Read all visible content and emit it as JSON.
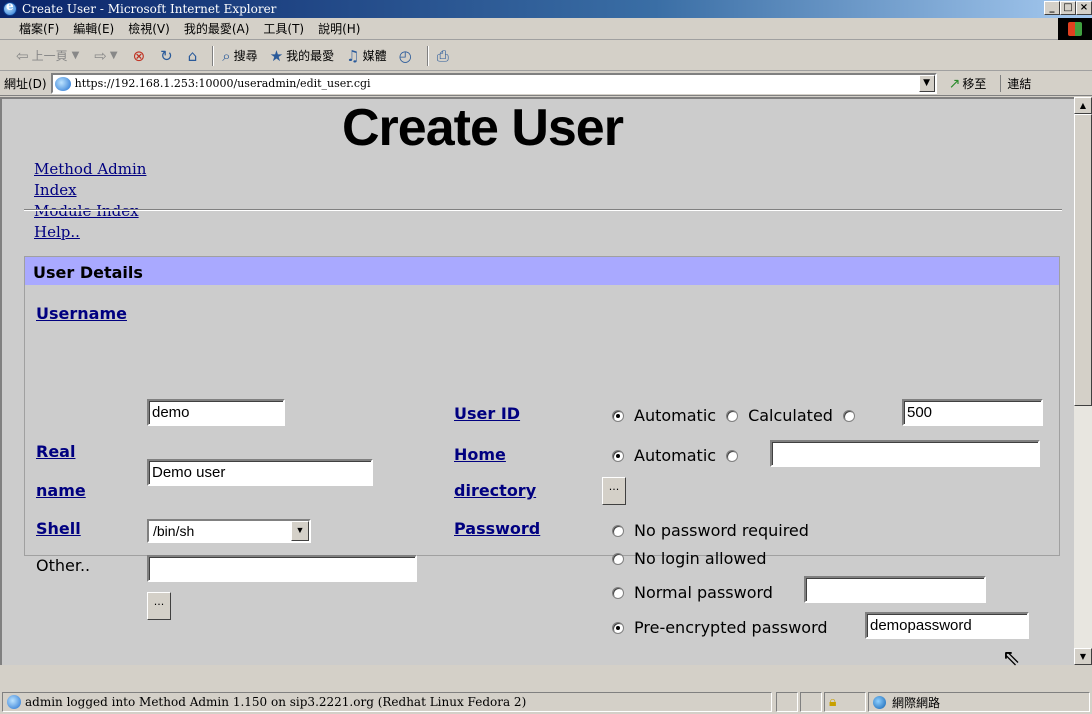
{
  "window": {
    "title": "Create User - Microsoft Internet Explorer",
    "min": "_",
    "max": "□",
    "close": "×"
  },
  "menu": [
    "檔案(F)",
    "編輯(E)",
    "檢視(V)",
    "我的最愛(A)",
    "工具(T)",
    "說明(H)"
  ],
  "toolbar": {
    "back": "上一頁",
    "search": "搜尋",
    "favorites": "我的最愛",
    "media": "媒體"
  },
  "address": {
    "label": "網址(D)",
    "url": "https://192.168.1.253:10000/useradmin/edit_user.cgi",
    "go": "移至",
    "links": "連結"
  },
  "nav": {
    "links": [
      "Method Admin",
      "Index",
      "Module Index",
      "Help.."
    ]
  },
  "page": {
    "title": "Create User"
  },
  "panel": {
    "header": "User Details",
    "username": {
      "label": "Username",
      "value": "demo"
    },
    "realname": {
      "label_line1": "Real",
      "label_line2": "name",
      "value": "Demo user"
    },
    "shell": {
      "label": "Shell",
      "selected": "/bin/sh"
    },
    "other": {
      "label": "Other..",
      "value": "",
      "browse": "..."
    },
    "userid": {
      "label": "User ID",
      "opt_automatic": "Automatic",
      "opt_calculated": "Calculated",
      "value": "500",
      "selected": "Automatic"
    },
    "homedir": {
      "label_line1": "Home",
      "label_line2": "directory",
      "opt_automatic": "Automatic",
      "value": "",
      "browse": "...",
      "selected": "Automatic"
    },
    "password": {
      "label": "Password",
      "opt_none": "No password required",
      "opt_nologin": "No login allowed",
      "opt_normal": "Normal password",
      "normal_value": "",
      "opt_preenc": "Pre-encrypted password",
      "preenc_value": "demopassword",
      "selected": "Pre-encrypted password"
    }
  },
  "status": {
    "text": "admin logged into Method Admin 1.150 on sip3.2221.org (Redhat Linux Fedora 2)",
    "zone": "網際網路"
  }
}
